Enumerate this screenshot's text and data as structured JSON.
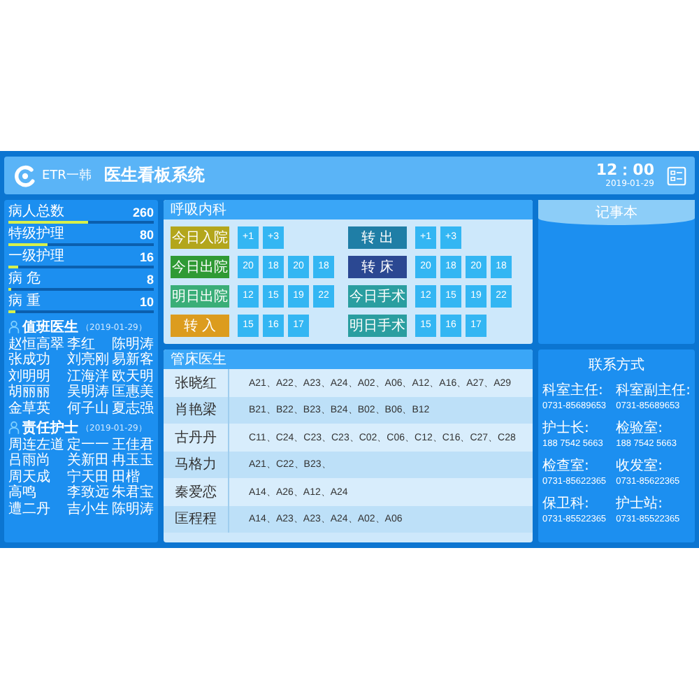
{
  "header": {
    "logo_text": "ETR一韩",
    "title": "医生看板系统",
    "time": "12：00",
    "date": "2019-01-29"
  },
  "stats": [
    {
      "label": "病人总数",
      "value": "260",
      "level": 0.55
    },
    {
      "label": "特级护理",
      "value": "80",
      "level": 0.27
    },
    {
      "label": "一级护理",
      "value": "16",
      "level": 0.07
    },
    {
      "label": "病 危",
      "value": "8",
      "level": 0.02
    },
    {
      "label": "病 重",
      "value": "10",
      "level": 0.05
    }
  ],
  "duty_doctors": {
    "title": "值班医生",
    "date": "（2019-01-29）",
    "names": [
      "赵恒高翠",
      "李红",
      "陈明涛",
      "张成功",
      "刘亮刚",
      "易新客",
      "刘明明",
      "江海洋",
      "欧天明",
      "胡丽丽",
      "吴明涛",
      "匡惠美",
      "金草英",
      "何子山",
      "夏志强"
    ]
  },
  "duty_nurses": {
    "title": "责任护士",
    "date": "（2019-01-29）",
    "names": [
      "周连左道",
      "定一一",
      "王佳君",
      "吕雨尚",
      "关新田",
      "冉玉玉",
      "周天成",
      "宁天田",
      "田楷",
      "高鸣",
      "李致远",
      "朱君宝",
      "遭二丹",
      "吉小生",
      "陈明涛"
    ]
  },
  "ward": {
    "title": "呼吸内科",
    "items": [
      {
        "label": "今日入院",
        "color": "#b3a61c",
        "values": [
          "+1",
          "+3"
        ]
      },
      {
        "label": "转 出",
        "color": "#1f7ea6",
        "values": [
          "+1",
          "+3"
        ]
      },
      {
        "label": "今日出院",
        "color": "#2f9a34",
        "values": [
          "20",
          "18",
          "20",
          "18"
        ]
      },
      {
        "label": "转 床",
        "color": "#2b4892",
        "values": [
          "20",
          "18",
          "20",
          "18"
        ]
      },
      {
        "label": "明日出院",
        "color": "#3aae78",
        "values": [
          "12",
          "15",
          "19",
          "22"
        ]
      },
      {
        "label": "今日手术",
        "color": "#2a9ea0",
        "values": [
          "12",
          "15",
          "19",
          "22"
        ]
      },
      {
        "label": "转 入",
        "color": "#dc9c1e",
        "values": [
          "15",
          "16",
          "17"
        ]
      },
      {
        "label": "明日手术",
        "color": "#2a9ea0",
        "values": [
          "15",
          "16",
          "17"
        ]
      }
    ]
  },
  "bed_doctors": {
    "title": "管床医生",
    "rows": [
      {
        "name": "张晓红",
        "beds": "A21、A22、A23、A24、A02、A06、A12、A16、A27、A29"
      },
      {
        "name": "肖艳梁",
        "beds": "B21、B22、B23、B24、B02、B06、B12"
      },
      {
        "name": "古丹丹",
        "beds": "C11、C24、C23、C23、C02、C06、C12、C16、C27、C28"
      },
      {
        "name": "马格力",
        "beds": "A21、C22、B23、"
      },
      {
        "name": "秦爱恋",
        "beds": "A14、A26、A12、A24"
      },
      {
        "name": "匡程程",
        "beds": "A14、A23、A23、A24、A02、A06"
      }
    ]
  },
  "notes": {
    "title": "记事本"
  },
  "contacts": {
    "title": "联系方式",
    "items": [
      {
        "label": "科室主任:",
        "phone": "0731-85689653"
      },
      {
        "label": "科室副主任:",
        "phone": "0731-85689653"
      },
      {
        "label": "护士长:",
        "phone": "188 7542 5663"
      },
      {
        "label": "检验室:",
        "phone": "188 7542 5663"
      },
      {
        "label": "检查室:",
        "phone": "0731-85622365"
      },
      {
        "label": "收发室:",
        "phone": "0731-85622365"
      },
      {
        "label": "保卫科:",
        "phone": "0731-85522365"
      },
      {
        "label": "护士站:",
        "phone": "0731-85522365"
      }
    ]
  }
}
